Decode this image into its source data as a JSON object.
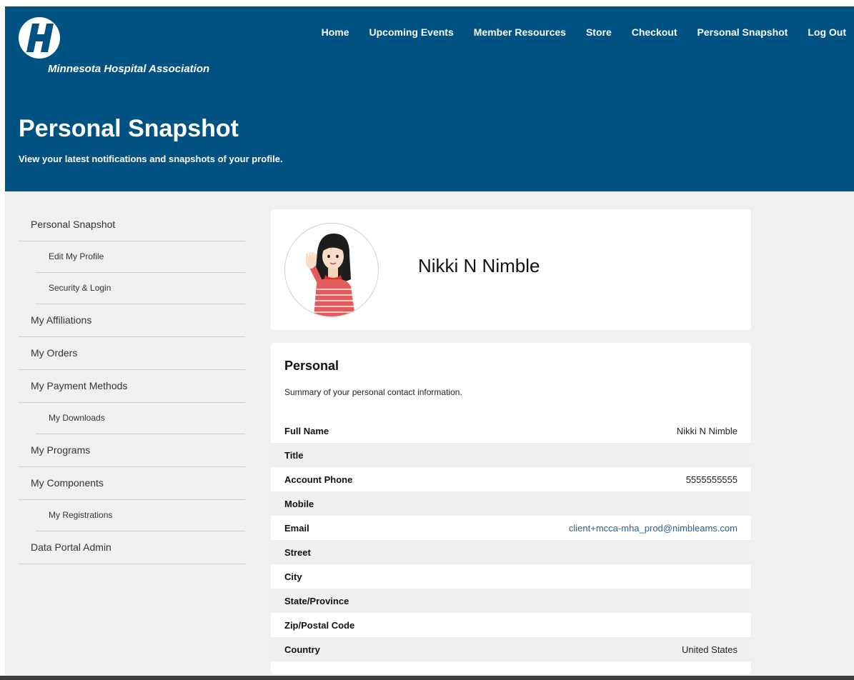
{
  "header": {
    "logo_text": "Minnesota Hospital Association",
    "nav": [
      "Home",
      "Upcoming Events",
      "Member Resources",
      "Store",
      "Checkout",
      "Personal Snapshot",
      "Log Out"
    ],
    "title": "Personal Snapshot",
    "subtitle": "View your latest notifications and snapshots of your profile."
  },
  "sidebar": {
    "items": [
      {
        "label": "Personal Snapshot",
        "sub": false
      },
      {
        "label": "Edit My Profile",
        "sub": true
      },
      {
        "label": "Security & Login",
        "sub": true
      },
      {
        "label": "My Affiliations",
        "sub": false
      },
      {
        "label": "My Orders",
        "sub": false
      },
      {
        "label": "My Payment Methods",
        "sub": false
      },
      {
        "label": "My Downloads",
        "sub": true
      },
      {
        "label": "My Programs",
        "sub": false
      },
      {
        "label": "My Components",
        "sub": false
      },
      {
        "label": "My Registrations",
        "sub": true
      },
      {
        "label": "Data Portal Admin",
        "sub": false
      }
    ]
  },
  "profile": {
    "name": "Nikki N Nimble"
  },
  "personal": {
    "title": "Personal",
    "description": "Summary of your personal contact information.",
    "rows": [
      {
        "label": "Full Name",
        "value": "Nikki N Nimble"
      },
      {
        "label": "Title",
        "value": ""
      },
      {
        "label": "Account Phone",
        "value": "5555555555"
      },
      {
        "label": "Mobile",
        "value": ""
      },
      {
        "label": "Email",
        "value": "client+mcca-mha_prod@nimbleams.com"
      },
      {
        "label": "Street",
        "value": ""
      },
      {
        "label": "City",
        "value": ""
      },
      {
        "label": "State/Province",
        "value": ""
      },
      {
        "label": "Zip/Postal Code",
        "value": ""
      },
      {
        "label": "Country",
        "value": "United States"
      }
    ]
  },
  "colors": {
    "header_bg": "#005282",
    "content_bg": "#f0f0f0",
    "link": "#2a5f8a"
  }
}
